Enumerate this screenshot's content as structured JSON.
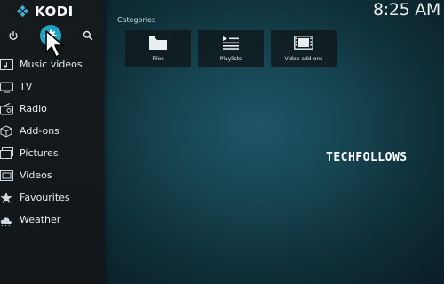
{
  "app": {
    "title": "KODI",
    "clock": "8:25 AM"
  },
  "top_icons": [
    "power-icon",
    "settings-icon",
    "search-icon"
  ],
  "menu": [
    {
      "label": "Music videos",
      "icon": "music-video-icon"
    },
    {
      "label": "TV",
      "icon": "tv-icon"
    },
    {
      "label": "Radio",
      "icon": "radio-icon"
    },
    {
      "label": "Add-ons",
      "icon": "addons-icon"
    },
    {
      "label": "Pictures",
      "icon": "pictures-icon"
    },
    {
      "label": "Videos",
      "icon": "videos-icon"
    },
    {
      "label": "Favourites",
      "icon": "star-icon"
    },
    {
      "label": "Weather",
      "icon": "weather-icon"
    }
  ],
  "main": {
    "section_title": "Categories",
    "tiles": [
      {
        "label": "Files",
        "icon": "folder-icon"
      },
      {
        "label": "Playlists",
        "icon": "playlist-icon"
      },
      {
        "label": "Video add-ons",
        "icon": "film-icon"
      }
    ]
  },
  "watermark": "TECHFOLLOWS",
  "colors": {
    "accent": "#1fa3c4",
    "sidebar": "#14191c",
    "tile": "#10181c"
  }
}
